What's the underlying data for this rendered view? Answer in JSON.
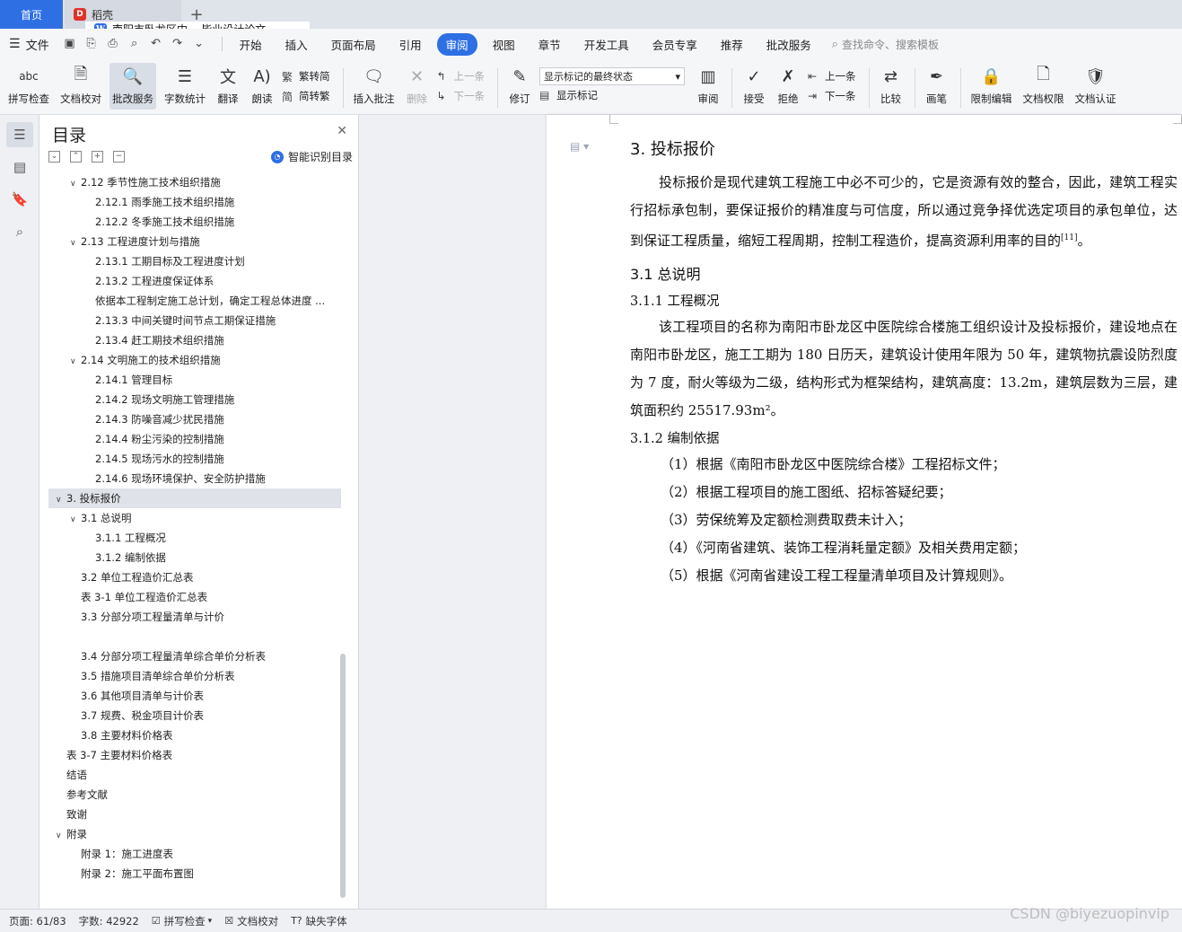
{
  "tabs": {
    "home": "首页",
    "wps": "稻壳",
    "doc": "南阳市卧龙区中... 毕业设计论文",
    "add": "+"
  },
  "menubar": {
    "file": "文件",
    "items": [
      "开始",
      "插入",
      "页面布局",
      "引用",
      "审阅",
      "视图",
      "章节",
      "开发工具",
      "会员专享",
      "推荐",
      "批改服务"
    ],
    "active": "审阅",
    "search_placeholder": "查找命令、搜索模板"
  },
  "ribbon": {
    "spellcheck": "拼写检查",
    "doccheck": "文档校对",
    "review_service": "批改服务",
    "wordcount": "字数统计",
    "translate": "翻译",
    "read": "朗读",
    "trad_to_simp": "繁转简",
    "simp_to_trad": "简转繁",
    "insert_comment": "插入批注",
    "delete": "删除",
    "prev": "上一条",
    "next": "下一条",
    "track": "修订",
    "markup_state": "显示标记的最终状态",
    "show_markup": "显示标记",
    "review": "审阅",
    "accept": "接受",
    "reject": "拒绝",
    "prev2": "上一条",
    "next2": "下一条",
    "compare": "比较",
    "pen": "画笔",
    "restrict_edit": "限制编辑",
    "doc_perm": "文档权限",
    "doc_cert": "文档认证"
  },
  "toc": {
    "title": "目录",
    "smart": "智能识别目录",
    "items": [
      {
        "level": "lv2",
        "toggle": "∨",
        "text": "2.12  季节性施工技术组织措施"
      },
      {
        "level": "lv3",
        "toggle": "",
        "text": "2.12.1  雨季施工技术组织措施"
      },
      {
        "level": "lv3",
        "toggle": "",
        "text": "2.12.2  冬季施工技术组织措施"
      },
      {
        "level": "lv2",
        "toggle": "∨",
        "text": "2.13  工程进度计划与措施"
      },
      {
        "level": "lv3",
        "toggle": "",
        "text": "2.13.1  工期目标及工程进度计划"
      },
      {
        "level": "lv3",
        "toggle": "",
        "text": "2.13.2  工程进度保证体系"
      },
      {
        "level": "lv3",
        "toggle": "",
        "text": "依据本工程制定施工总计划，确定工程总体进度 ..."
      },
      {
        "level": "lv3",
        "toggle": "",
        "text": "2.13.3  中间关键时间节点工期保证措施"
      },
      {
        "level": "lv3",
        "toggle": "",
        "text": "2.13.4  赶工期技术组织措施"
      },
      {
        "level": "lv2",
        "toggle": "∨",
        "text": "2.14  文明施工的技术组织措施"
      },
      {
        "level": "lv3",
        "toggle": "",
        "text": "2.14.1  管理目标"
      },
      {
        "level": "lv3",
        "toggle": "",
        "text": "2.14.2  现场文明施工管理措施"
      },
      {
        "level": "lv3",
        "toggle": "",
        "text": "2.14.3  防噪音减少扰民措施"
      },
      {
        "level": "lv3",
        "toggle": "",
        "text": "2.14.4  粉尘污染的控制措施"
      },
      {
        "level": "lv3",
        "toggle": "",
        "text": "2.14.5  现场污水的控制措施"
      },
      {
        "level": "lv3",
        "toggle": "",
        "text": "2.14.6  现场环境保护、安全防护措施"
      },
      {
        "level": "lv1",
        "toggle": "∨",
        "text": "3.  投标报价",
        "selected": true
      },
      {
        "level": "lv2",
        "toggle": "∨",
        "text": "3.1  总说明"
      },
      {
        "level": "lv3",
        "toggle": "",
        "text": "3.1.1  工程概况"
      },
      {
        "level": "lv3",
        "toggle": "",
        "text": "3.1.2  编制依据"
      },
      {
        "level": "lv2n",
        "toggle": "",
        "text": "3.2  单位工程造价汇总表"
      },
      {
        "level": "lv2n",
        "toggle": "",
        "text": "表  3-1  单位工程造价汇总表"
      },
      {
        "level": "lv2n",
        "toggle": "",
        "text": "3.3  分部分项工程量清单与计价"
      },
      {
        "level": "lv2n",
        "toggle": "",
        "text": ""
      },
      {
        "level": "lv2n",
        "toggle": "",
        "text": "3.4  分部分项工程量清单综合单价分析表"
      },
      {
        "level": "lv2n",
        "toggle": "",
        "text": "3.5  措施项目清单综合单价分析表"
      },
      {
        "level": "lv2n",
        "toggle": "",
        "text": "3.6  其他项目清单与计价表"
      },
      {
        "level": "lv2n",
        "toggle": "",
        "text": "3.7  规费、税金项目计价表"
      },
      {
        "level": "lv2n",
        "toggle": "",
        "text": "3.8  主要材料价格表"
      },
      {
        "level": "lv1n",
        "toggle": "",
        "text": "表 3-7  主要材料价格表"
      },
      {
        "level": "lv1n",
        "toggle": "",
        "text": "结语"
      },
      {
        "level": "lv1n",
        "toggle": "",
        "text": "参考文献"
      },
      {
        "level": "lv1n",
        "toggle": "",
        "text": "致谢"
      },
      {
        "level": "lv1",
        "toggle": "∨",
        "text": "附录"
      },
      {
        "level": "lv2n",
        "toggle": "",
        "text": "附录 1：施工进度表"
      },
      {
        "level": "lv2n",
        "toggle": "",
        "text": "附录 2：施工平面布置图"
      }
    ]
  },
  "document": {
    "h1": "3.  投标报价",
    "p1": "投标报价是现代建筑工程施工中必不可少的，它是资源有效的整合，因此，建筑工程实行招标承包制，要保证报价的精准度与可信度，所以通过竞争择优选定项目的承包单位，达到保证工程质量，缩短工程周期，控制工程造价，提高资源利用率的目的",
    "p1_ref": "[11]",
    "p1_end": "。",
    "h2": "3.1  总说明",
    "h3a": "3.1.1  工程概况",
    "p2": "该工程项目的名称为南阳市卧龙区中医院综合楼施工组织设计及投标报价，建设地点在南阳市卧龙区，施工工期为 180 日历天，建筑设计使用年限为 50 年，建筑物抗震设防烈度为 7 度，耐火等级为二级，结构形式为框架结构，建筑高度：13.2m，建筑层数为三层，建筑面积约 25517.93m²。",
    "h3b": "3.1.2  编制依据",
    "list": [
      "（1）根据《南阳市卧龙区中医院综合楼》工程招标文件；",
      "（2）根据工程项目的施工图纸、招标答疑纪要；",
      "（3）劳保统筹及定额检测费取费未计入；",
      "（4）《河南省建筑、装饰工程消耗量定额》及相关费用定额；",
      "（5）根据《河南省建设工程工程量清单项目及计算规则》。"
    ]
  },
  "status": {
    "page": "页面: 61/83",
    "words": "字数: 42922",
    "spell": "拼写检查",
    "proof": "文档校对",
    "missing_font": "缺失字体"
  },
  "watermark": "CSDN @biyezuopinvip"
}
